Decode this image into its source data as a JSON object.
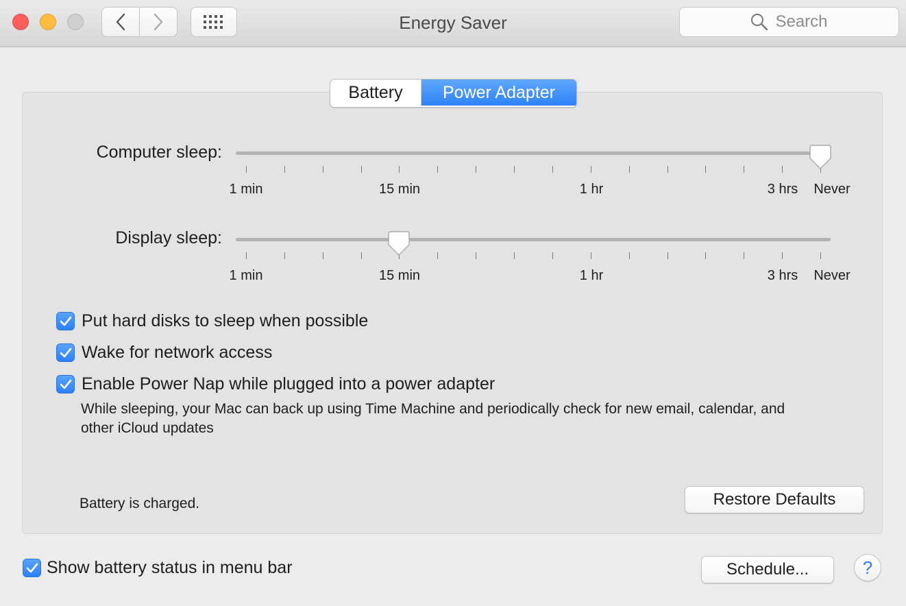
{
  "window": {
    "title": "Energy Saver",
    "search_placeholder": "Search"
  },
  "tabs": [
    {
      "label": "Battery",
      "selected": false
    },
    {
      "label": "Power Adapter",
      "selected": true
    }
  ],
  "sliders": {
    "tick_labels": [
      "1 min",
      "15 min",
      "1 hr",
      "3 hrs",
      "Never"
    ],
    "computer_sleep": {
      "label": "Computer sleep:",
      "value": "Never"
    },
    "display_sleep": {
      "label": "Display sleep:",
      "value": "15 min"
    }
  },
  "options": [
    {
      "label": "Put hard disks to sleep when possible",
      "checked": true
    },
    {
      "label": "Wake for network access",
      "checked": true
    },
    {
      "label": "Enable Power Nap while plugged into a power adapter",
      "checked": true
    }
  ],
  "power_nap_description": "While sleeping, your Mac can back up using Time Machine and periodically check for new email, calendar, and other iCloud updates",
  "status_text": "Battery is charged.",
  "buttons": {
    "restore_defaults": "Restore Defaults",
    "schedule": "Schedule...",
    "help": "?"
  },
  "footer": {
    "show_battery_status": {
      "label": "Show battery status in menu bar",
      "checked": true
    }
  },
  "colors": {
    "accent": "#2f82f7",
    "close": "#fc605c",
    "minimize": "#fdbc40",
    "zoom_disabled": "#cfcfcf"
  }
}
